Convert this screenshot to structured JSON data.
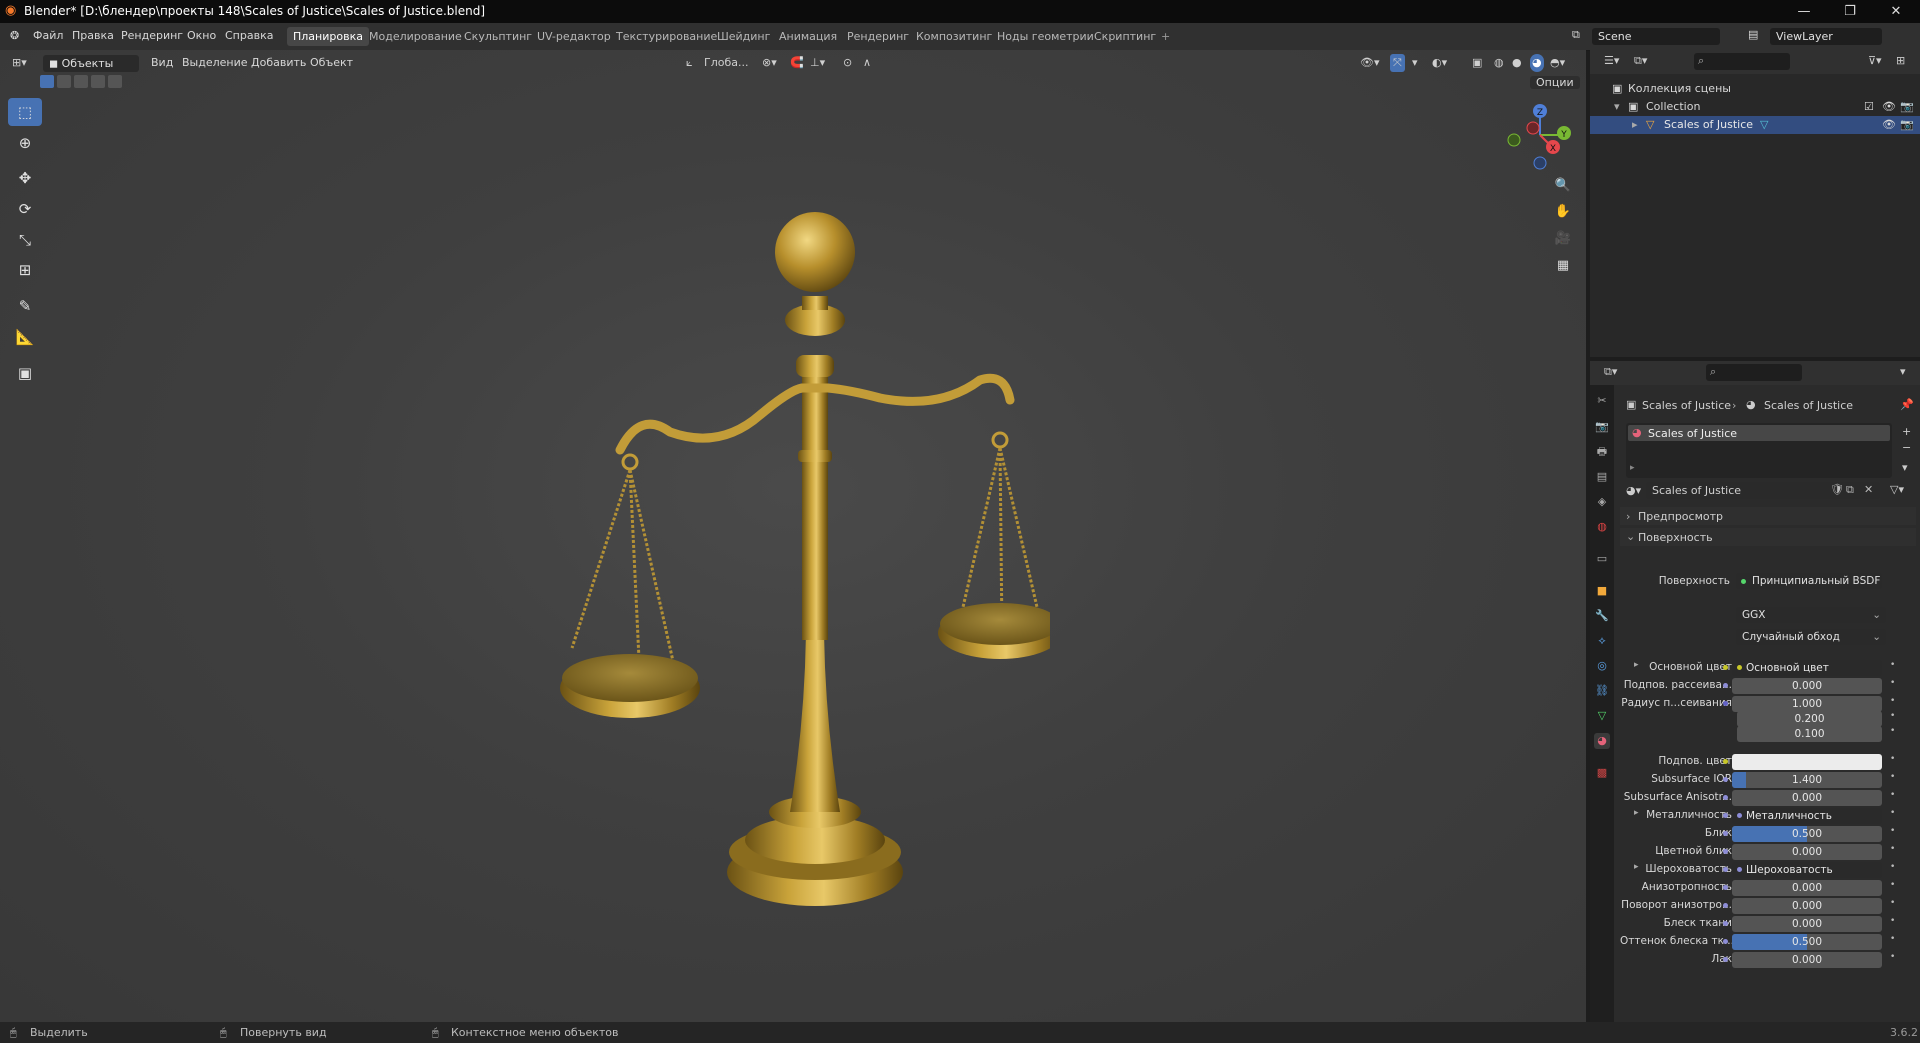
{
  "window": {
    "title": "Blender* [D:\\блендер\\проекты 148\\Scales of Justice\\Scales of Justice.blend]",
    "minimize": "—",
    "maximize": "❐",
    "close": "✕"
  },
  "menu": [
    "Файл",
    "Правка",
    "Рендеринг",
    "Окно",
    "Справка"
  ],
  "workspaces": [
    {
      "label": "Планировка",
      "active": true
    },
    {
      "label": "Моделирование"
    },
    {
      "label": "Скульптинг"
    },
    {
      "label": "UV-редактор"
    },
    {
      "label": "Текстурирование"
    },
    {
      "label": "Шейдинг"
    },
    {
      "label": "Анимация"
    },
    {
      "label": "Рендеринг"
    },
    {
      "label": "Композитинг"
    },
    {
      "label": "Ноды геометрии"
    },
    {
      "label": "Скриптинг"
    }
  ],
  "workspace_add": "+",
  "scene_name": "Scene",
  "view_layer": "ViewLayer",
  "viewport": {
    "mode": "Объекты",
    "menus": [
      "Вид",
      "Выделение",
      "Добавить",
      "Объект"
    ],
    "orientation": "Глоба...",
    "options_label": "Опции",
    "gizmo_x": "X",
    "gizmo_y": "Y",
    "gizmo_z": "Z"
  },
  "outliner": {
    "scene_collection": "Коллекция сцены",
    "collection": "Collection",
    "object": "Scales of Justice"
  },
  "properties": {
    "breadcrumb_object": "Scales of Justice",
    "breadcrumb_material": "Scales of Justice",
    "material_slot": "Scales of Justice",
    "material_name": "Scales of Justice",
    "section_preview": "Предпросмотр",
    "section_surface": "Поверхность",
    "surface_label": "Поверхность",
    "surface_shader": "Принципиальный BSDF",
    "distribution": "GGX",
    "subsurface_method": "Случайный обход",
    "rows": [
      {
        "label": "Основной цвет",
        "value": "Основной цвет",
        "type": "link",
        "dot": "#c7c729",
        "expand": true
      },
      {
        "label": "Подпов. рассеива...",
        "value": "0.000",
        "type": "num",
        "dot": "#8c8cd6"
      },
      {
        "label": "Радиус п...сеивания",
        "value": "1.000",
        "type": "num",
        "dot": "#6363c7"
      },
      {
        "label": "",
        "value": "0.200",
        "type": "num"
      },
      {
        "label": "",
        "value": "0.100",
        "type": "num"
      },
      {
        "label": "Подпов. цвет",
        "value": "",
        "type": "color",
        "dot": "#c7c729"
      },
      {
        "label": "Subsurface IOR",
        "value": "1.400",
        "type": "num",
        "dot": "#8c8cd6",
        "fill": 0.09
      },
      {
        "label": "Subsurface Anisotr...",
        "value": "0.000",
        "type": "num",
        "dot": "#8c8cd6"
      },
      {
        "label": "Металличность",
        "value": "Металличность",
        "type": "link",
        "dot": "#8c8cd6",
        "expand": true
      },
      {
        "label": "Блик",
        "value": "0.500",
        "type": "num",
        "dot": "#8c8cd6",
        "fill": 0.5
      },
      {
        "label": "Цветной блик",
        "value": "0.000",
        "type": "num",
        "dot": "#8c8cd6"
      },
      {
        "label": "Шероховатость",
        "value": "Шероховатость",
        "type": "link",
        "dot": "#8c8cd6",
        "expand": true
      },
      {
        "label": "Анизотропность",
        "value": "0.000",
        "type": "num",
        "dot": "#8c8cd6"
      },
      {
        "label": "Поворот анизотро...",
        "value": "0.000",
        "type": "num",
        "dot": "#8c8cd6"
      },
      {
        "label": "Блеск ткани",
        "value": "0.000",
        "type": "num",
        "dot": "#8c8cd6"
      },
      {
        "label": "Оттенок блеска тк...",
        "value": "0.500",
        "type": "num",
        "dot": "#8c8cd6",
        "fill": 0.5
      },
      {
        "label": "Лак",
        "value": "0.000",
        "type": "num",
        "dot": "#8c8cd6"
      }
    ]
  },
  "status": {
    "select": "Выделить",
    "rotate": "Повернуть вид",
    "context_menu": "Контекстное меню объектов",
    "version": "3.6.2"
  },
  "colors": {
    "accent": "#4772b3",
    "selection": "#334d80",
    "brass": "#b8962e"
  }
}
